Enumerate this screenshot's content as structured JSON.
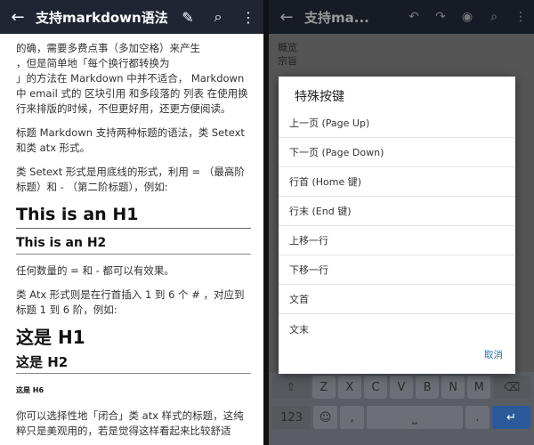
{
  "left": {
    "title": "支持markdown语法",
    "icons": {
      "back": "←",
      "edit": "✎",
      "search": "⌕",
      "more": "⋮"
    },
    "paragraphs": [
      "的确，需要多费点事（多加空格）来产生\n，但是简单地「每个换行都转换为\n」的方法在 Markdown 中并不适合， Markdown 中 email 式的 区块引用 和多段落的 列表 在使用换行来排版的时候，不但更好用，还更方便阅读。",
      "标题 Markdown 支持两种标题的语法，类 Setext 和类 atx 形式。",
      "类 Setext 形式是用底线的形式，利用 = （最高阶标题）和 - （第二阶标题），例如:"
    ],
    "h1_example": "This is an H1",
    "h2_example": "This is an H2",
    "p_any": "任何数量的 = 和 - 都可以有效果。",
    "p_atx": "类 Atx 形式则是在行首插入 1 到 6 个 # ，对应到标题 1 到 6 阶，例如:",
    "h1_zh": "这是 H1",
    "h2_zh": "这是 H2",
    "h6_zh": "这是 H6",
    "p_tail": "你可以选择性地「闭合」类 atx 样式的标题，这纯粹只是美观用的，若是觉得这样看起来比较舒适"
  },
  "right": {
    "title": "支持ma...",
    "editor_lines": [
      "概览",
      "宗旨"
    ],
    "dialog": {
      "title": "特殊按键",
      "items": [
        "上一页 (Page Up)",
        "下一页 (Page Down)",
        "行首 (Home 键)",
        "行末 (End 键)",
        "上移一行",
        "下移一行",
        "文首",
        "文末"
      ],
      "cancel": "取消"
    },
    "keyboard": {
      "row1": [
        "⇧",
        "Z",
        "X",
        "C",
        "V",
        "B",
        "N",
        "M",
        "⌫"
      ],
      "row2": [
        "123",
        "☺",
        ",",
        "⎵",
        ".",
        "↵"
      ]
    }
  }
}
